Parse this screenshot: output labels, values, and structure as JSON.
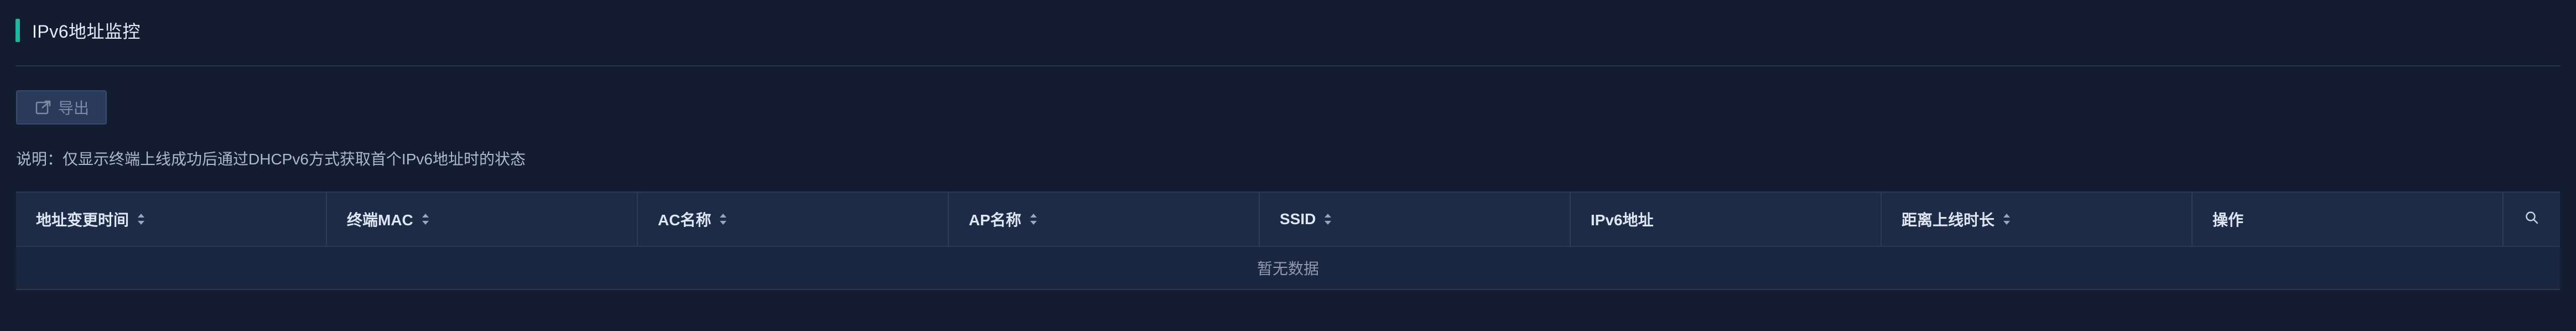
{
  "header": {
    "title": "IPv6地址监控",
    "accent_color": "#1fb5a1"
  },
  "toolbar": {
    "export_label": "导出",
    "export_icon": "export-icon",
    "export_disabled": true
  },
  "note": {
    "text": "说明：仅显示终端上线成功后通过DHCPv6方式获取首个IPv6地址时的状态"
  },
  "table": {
    "columns": [
      {
        "label": "地址变更时间",
        "sortable": true
      },
      {
        "label": "终端MAC",
        "sortable": true
      },
      {
        "label": "AC名称",
        "sortable": true
      },
      {
        "label": "AP名称",
        "sortable": true
      },
      {
        "label": "SSID",
        "sortable": true
      },
      {
        "label": "IPv6地址",
        "sortable": false
      },
      {
        "label": "距离上线时长",
        "sortable": true
      },
      {
        "label": "操作",
        "sortable": false
      }
    ],
    "search_icon": "search-icon",
    "empty_text": "暂无数据",
    "rows": []
  }
}
